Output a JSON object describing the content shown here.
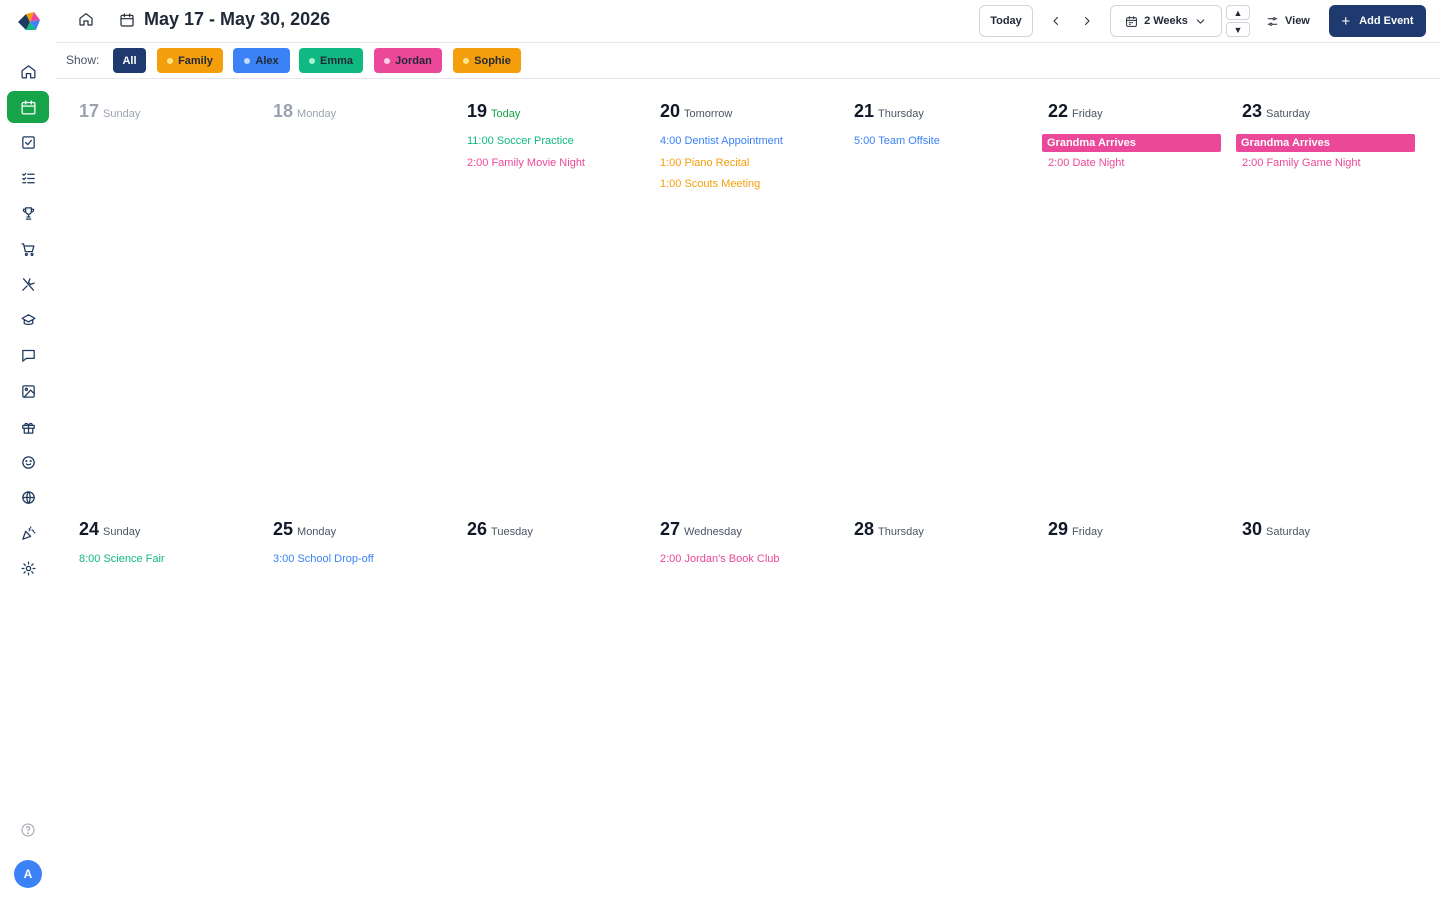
{
  "header": {
    "range_title": "May 17 - May 30, 2026",
    "today_label": "Today",
    "range_label": "2 Weeks",
    "view_label": "View",
    "add_event_label": "Add Event",
    "up_glyph": "▲",
    "down_glyph": "▼"
  },
  "sidebar": {
    "items": [
      {
        "icon": "home-icon"
      },
      {
        "icon": "calendar-icon",
        "active": true
      },
      {
        "icon": "checkbox-icon"
      },
      {
        "icon": "checklist-icon"
      },
      {
        "icon": "trophy-icon"
      },
      {
        "icon": "cart-icon"
      },
      {
        "icon": "utensils-icon"
      },
      {
        "icon": "chef-hat-icon"
      },
      {
        "icon": "chat-icon"
      },
      {
        "icon": "image-icon"
      },
      {
        "icon": "gift-icon"
      },
      {
        "icon": "smiley-icon"
      },
      {
        "icon": "globe-icon"
      },
      {
        "icon": "party-icon"
      },
      {
        "icon": "settings-icon"
      }
    ],
    "avatar_initial": "A"
  },
  "filters": {
    "show_label": "Show:",
    "chips": [
      {
        "label": "All",
        "bg": "#1e3a6e",
        "fg": "#ffffff",
        "dot": null
      },
      {
        "label": "Family",
        "bg": "#f59e0b",
        "fg": "#1f2937",
        "dot": "#fde68a"
      },
      {
        "label": "Alex",
        "bg": "#3b82f6",
        "fg": "#1f2937",
        "dot": "#bfdbfe"
      },
      {
        "label": "Emma",
        "bg": "#10b981",
        "fg": "#1f2937",
        "dot": "#a7f3d0"
      },
      {
        "label": "Jordan",
        "bg": "#ec4899",
        "fg": "#1f2937",
        "dot": "#fbcfe8"
      },
      {
        "label": "Sophie",
        "bg": "#f59e0b",
        "fg": "#1f2937",
        "dot": "#fde68a"
      }
    ]
  },
  "colors": {
    "family": "#f59e0b",
    "alex": "#3b82f6",
    "emma": "#10b981",
    "jordan": "#ec4899",
    "accent_active": "#16a34a",
    "primary": "#1e3a6e"
  },
  "weeks": [
    {
      "days": [
        {
          "num": "17",
          "name": "Sunday",
          "state": "past",
          "events": []
        },
        {
          "num": "18",
          "name": "Monday",
          "state": "past",
          "events": []
        },
        {
          "num": "19",
          "name": "Today",
          "state": "today",
          "events": [
            {
              "type": "text",
              "text": "11:00 Soccer Practice",
              "color": "#10b981"
            },
            {
              "type": "text",
              "text": "2:00 Family Movie Night",
              "color": "#ec4899"
            }
          ]
        },
        {
          "num": "20",
          "name": "Tomorrow",
          "state": "future",
          "events": [
            {
              "type": "text",
              "text": "4:00 Dentist Appointment",
              "color": "#3b82f6"
            },
            {
              "type": "text",
              "text": "1:00 Piano Recital",
              "color": "#f59e0b"
            },
            {
              "type": "text",
              "text": "1:00 Scouts Meeting",
              "color": "#f59e0b"
            }
          ]
        },
        {
          "num": "21",
          "name": "Thursday",
          "state": "future",
          "events": [
            {
              "type": "text",
              "text": "5:00 Team Offsite",
              "color": "#3b82f6"
            }
          ]
        },
        {
          "num": "22",
          "name": "Friday",
          "state": "future",
          "events": [
            {
              "type": "bar",
              "text": "Grandma Arrives",
              "color": "#ec4899"
            },
            {
              "type": "text",
              "text": "2:00 Date Night",
              "color": "#ec4899"
            }
          ]
        },
        {
          "num": "23",
          "name": "Saturday",
          "state": "future",
          "events": [
            {
              "type": "bar",
              "text": "Grandma Arrives",
              "color": "#ec4899"
            },
            {
              "type": "text",
              "text": "2:00 Family Game Night",
              "color": "#ec4899"
            }
          ]
        }
      ]
    },
    {
      "days": [
        {
          "num": "24",
          "name": "Sunday",
          "state": "future",
          "events": [
            {
              "type": "text",
              "text": "8:00 Science Fair",
              "color": "#10b981"
            }
          ]
        },
        {
          "num": "25",
          "name": "Monday",
          "state": "future",
          "events": [
            {
              "type": "text",
              "text": "3:00 School Drop-off",
              "color": "#3b82f6"
            }
          ]
        },
        {
          "num": "26",
          "name": "Tuesday",
          "state": "future",
          "events": []
        },
        {
          "num": "27",
          "name": "Wednesday",
          "state": "future",
          "events": [
            {
              "type": "text",
              "text": "2:00 Jordan's Book Club",
              "color": "#ec4899"
            }
          ]
        },
        {
          "num": "28",
          "name": "Thursday",
          "state": "future",
          "events": []
        },
        {
          "num": "29",
          "name": "Friday",
          "state": "future",
          "events": []
        },
        {
          "num": "30",
          "name": "Saturday",
          "state": "future",
          "events": []
        }
      ]
    }
  ]
}
